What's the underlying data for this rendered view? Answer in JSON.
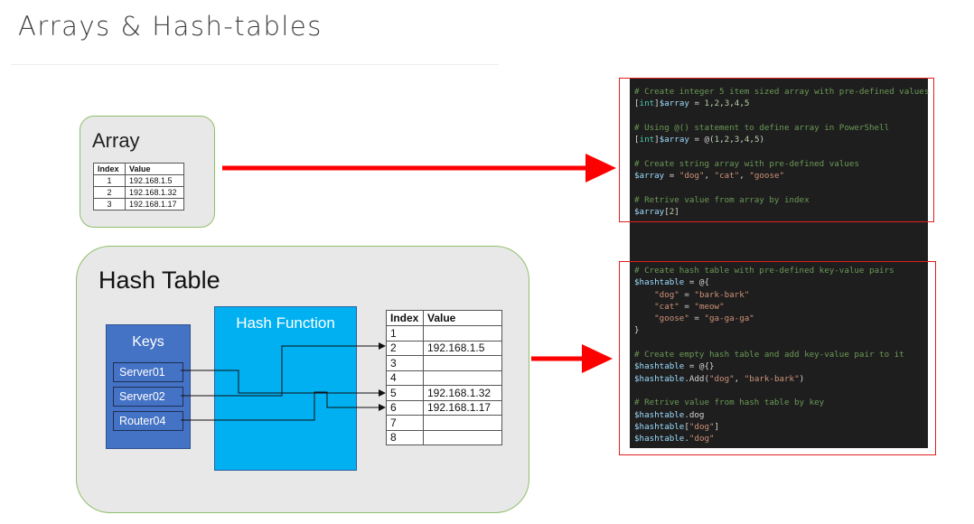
{
  "page_title": "Arrays & Hash-tables",
  "array_panel": {
    "title": "Array",
    "headers": [
      "Index",
      "Value"
    ],
    "rows": [
      [
        "1",
        "192.168.1.5"
      ],
      [
        "2",
        "192.168.1.32"
      ],
      [
        "3",
        "192.168.1.17"
      ]
    ]
  },
  "hash_panel": {
    "title": "Hash Table",
    "keys_title": "Keys",
    "keys": [
      "Server01",
      "Server02",
      "Router04"
    ],
    "hash_function_title": "Hash Function",
    "bucket_headers": [
      "Index",
      "Value"
    ],
    "buckets": [
      [
        "1",
        ""
      ],
      [
        "2",
        "192.168.1.5"
      ],
      [
        "3",
        ""
      ],
      [
        "4",
        ""
      ],
      [
        "5",
        "192.168.1.32"
      ],
      [
        "6",
        "192.168.1.17"
      ],
      [
        "7",
        ""
      ],
      [
        "8",
        ""
      ]
    ]
  },
  "code_array": [
    "# Create integer 5 item sized array with pre-defined values",
    "[int]$array = 1,2,3,4,5",
    "",
    "# Using @() statement to define array in PowerShell",
    "[int]$array = @(1,2,3,4,5)",
    "",
    "# Create string array with pre-defined values",
    "$array = \"dog\", \"cat\", \"goose\"",
    "",
    "# Retrive value from array by index",
    "$array[2]"
  ],
  "code_hashtable": [
    "# Create hash table with pre-defined key-value pairs",
    "$hashtable = @{",
    "    \"dog\" = \"bark-bark\"",
    "    \"cat\" = \"meow\"",
    "    \"goose\" = \"ga-ga-ga\"",
    "}",
    "",
    "# Create empty hash table and add key-value pair to it",
    "$hashtable = @{}",
    "$hashtable.Add(\"dog\", \"bark-bark\")",
    "",
    "# Retrive value from hash table by key",
    "$hashtable.dog",
    "$hashtable[\"dog\"]",
    "$hashtable.\"dog\""
  ],
  "colors": {
    "panel_bg": "#e8e8e8",
    "panel_border": "#8fbf6a",
    "keys_fill": "#4472c4",
    "hash_function_fill": "#00b0f0",
    "arrow_red": "#ff0000",
    "highlight_red": "#e01e1e",
    "code_bg": "#1e1e1e"
  }
}
